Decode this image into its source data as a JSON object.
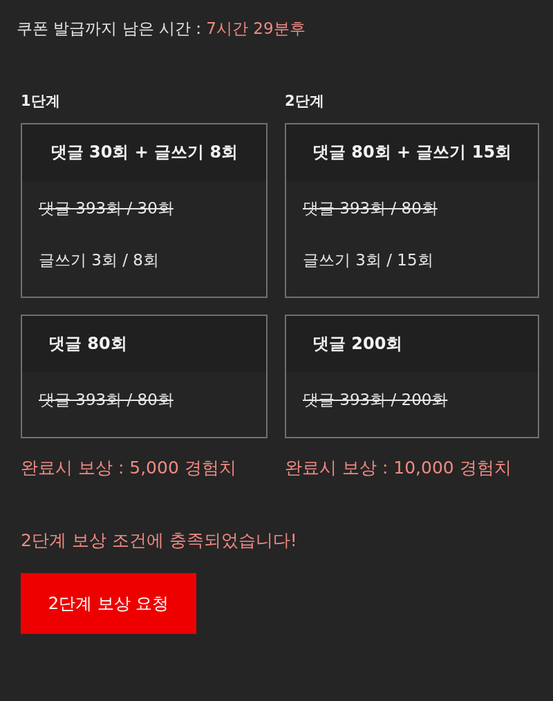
{
  "timer": {
    "label": "쿠폰 발급까지 남은 시간 : ",
    "value": "7시간 29분후"
  },
  "stages": [
    {
      "title": "1단계",
      "missions": [
        {
          "title": "댓글 30회 + 글쓰기 8회",
          "kind": "combined",
          "progress": [
            {
              "text": "댓글 393회 / 30회",
              "done": true
            },
            {
              "text": "글쓰기 3회 / 8회",
              "done": false
            }
          ]
        },
        {
          "title": "댓글 80회",
          "kind": "single",
          "progress": [
            {
              "text": "댓글 393회 / 80회",
              "done": true
            }
          ]
        }
      ],
      "reward": "완료시 보상 : 5,000 경험치"
    },
    {
      "title": "2단계",
      "missions": [
        {
          "title": "댓글 80회 + 글쓰기 15회",
          "kind": "combined",
          "progress": [
            {
              "text": "댓글 393회 / 80회",
              "done": true
            },
            {
              "text": "글쓰기 3회 / 15회",
              "done": false
            }
          ]
        },
        {
          "title": "댓글 200회",
          "kind": "single",
          "progress": [
            {
              "text": "댓글 393회 / 200회",
              "done": true
            }
          ]
        }
      ],
      "reward": "완료시 보상 : 10,000 경험치"
    }
  ],
  "notice": "2단계 보상 조건에 충족되었습니다!",
  "button": {
    "label": "2단계 보상 요청"
  }
}
